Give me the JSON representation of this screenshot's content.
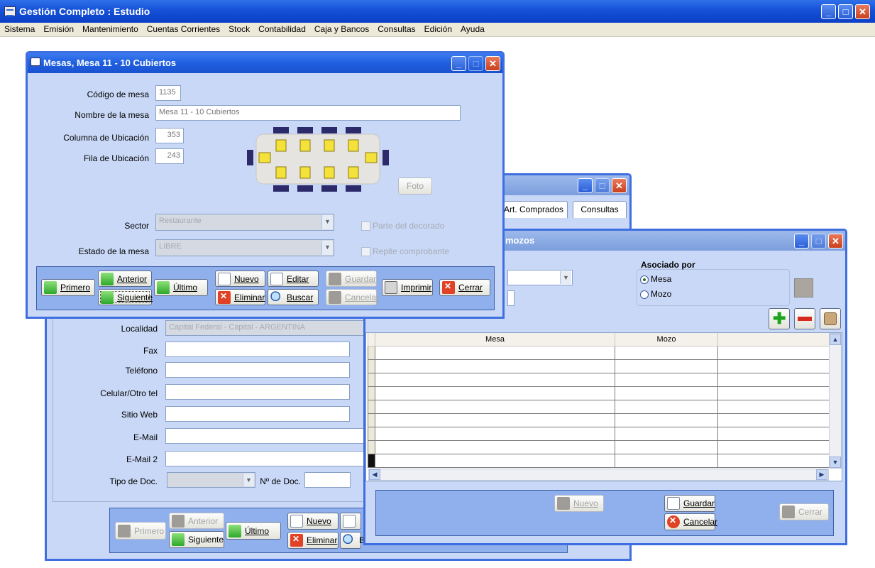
{
  "app": {
    "title": "Gestión Completo : Estudio",
    "min": "_",
    "max": "□",
    "close": "✕"
  },
  "menu": [
    "Sistema",
    "Emisión",
    "Mantenimiento",
    "Cuentas Corrientes",
    "Stock",
    "Contabilidad",
    "Caja y Bancos",
    "Consultas",
    "Edición",
    "Ayuda"
  ],
  "mesas": {
    "title": "Mesas, Mesa 11 - 10 Cubiertos",
    "codigo_label": "Código de mesa",
    "codigo": "1135",
    "nombre_label": "Nombre de la mesa",
    "nombre": "Mesa 11 - 10 Cubiertos",
    "columna_label": "Columna de Ubicación",
    "columna": "353",
    "fila_label": "Fila de Ubicación",
    "fila": "243",
    "foto": "Foto",
    "sector_label": "Sector",
    "sector": "Restaurante",
    "estado_label": "Estado de la mesa",
    "estado": "LIBRE",
    "decorado": "Parte del decorado",
    "repite": "Repite comprobante",
    "buttons": {
      "primero": "Primero",
      "anterior": "Anterior",
      "siguiente": "Siguiente",
      "ultimo": "Último",
      "nuevo": "Nuevo",
      "eliminar": "Eliminar",
      "editar": "Editar",
      "buscar": "Buscar",
      "guardar": "Guardar",
      "cancelar": "Cancelar",
      "imprimir": "Imprimir",
      "cerrar": "Cerrar"
    }
  },
  "clientes": {
    "tabs": [
      "Art. Comprados",
      "Consultas"
    ],
    "localidad_label": "Localidad",
    "localidad": "Capital Federal - Capital - ARGENTINA",
    "fax_label": "Fax",
    "telefono_label": "Teléfono",
    "celular_label": "Celular/Otro tel",
    "web_label": "Sitio Web",
    "email_label": "E-Mail",
    "email2_label": "E-Mail 2",
    "tipodoc_label": "Tipo de Doc.",
    "nrodoc_label": "Nº de Doc.",
    "buttons": {
      "primero": "Primero",
      "anterior": "Anterior",
      "siguiente": "Siguiente",
      "ultimo": "Último",
      "nuevo": "Nuevo",
      "eliminar": "Eliminar",
      "b": "B"
    }
  },
  "mozos": {
    "title": "mozos",
    "asociado_label": "Asociado por",
    "radio_mesa": "Mesa",
    "radio_mozo": "Mozo",
    "col_mesa": "Mesa",
    "col_mozo": "Mozo",
    "buttons": {
      "nuevo": "Nuevo",
      "guardar": "Guardar",
      "cancelar": "Cancelar",
      "cerrar": "Cerrar"
    }
  },
  "colors": {
    "titlebar": "#1f5fe0",
    "window_bg": "#c9d8f6",
    "toolbar": "#8fb0ec"
  }
}
